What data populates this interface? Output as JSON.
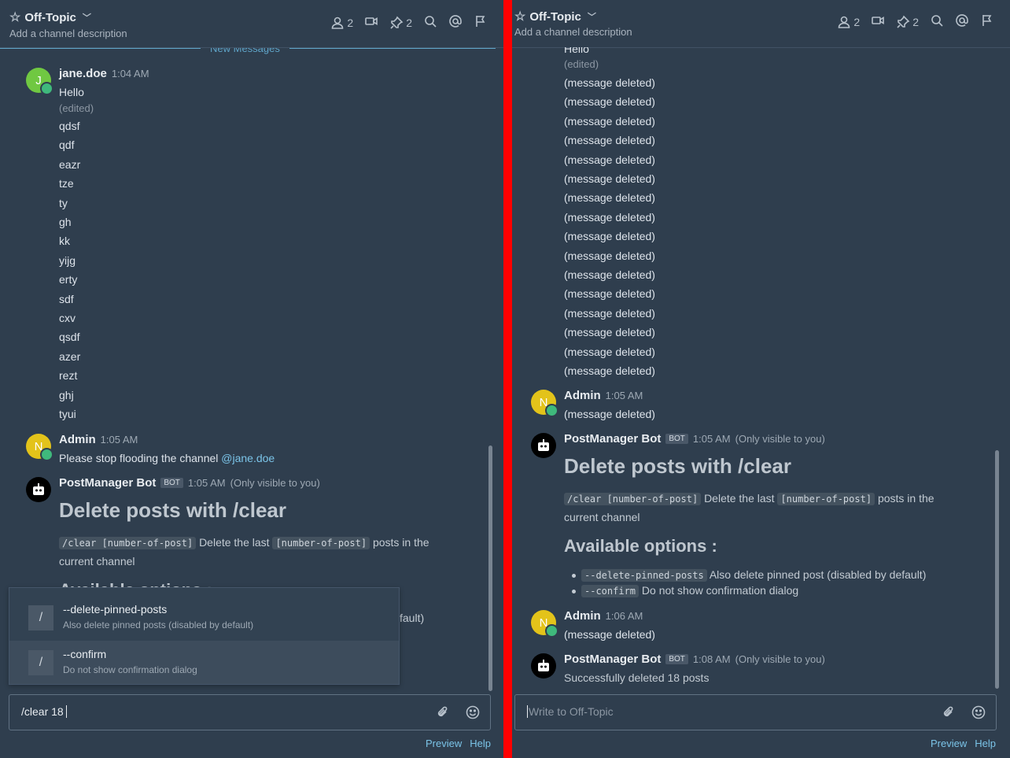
{
  "left": {
    "header": {
      "channel": "Off-Topic",
      "description": "Add a channel description",
      "members": "2",
      "pinned": "2"
    },
    "new_messages": "New Messages",
    "post1": {
      "user": "jane.doe",
      "time": "1:04 AM",
      "avatar": "J",
      "first": "Hello",
      "edited": "(edited)",
      "lines": [
        "qdsf",
        "qdf",
        "eazr",
        "tze",
        "ty",
        "gh",
        "kk",
        "yijg",
        "erty",
        "sdf",
        "cxv",
        "qsdf",
        "azer",
        "rezt",
        "ghj",
        "tyui"
      ]
    },
    "post2": {
      "user": "Admin",
      "time": "1:05 AM",
      "avatar": "N",
      "text": "Please stop flooding the channel ",
      "mention": "@jane.doe"
    },
    "post3": {
      "user": "PostManager Bot",
      "bot_badge": "BOT",
      "time": "1:05 AM",
      "visibility": "(Only visible to you)",
      "heading": "Delete posts with /clear",
      "code1": "/clear [number-of-post]",
      "desc_a": "Delete the last",
      "code2": "[number-of-post]",
      "desc_b": "posts in the",
      "desc_c": "current channel",
      "options_heading": "Available options :",
      "partial": "fault)"
    },
    "suggestions": [
      {
        "icon": "/",
        "title": "--delete-pinned-posts",
        "desc": "Also delete pinned posts (disabled by default)"
      },
      {
        "icon": "/",
        "title": "--confirm",
        "desc": "Do not show confirmation dialog"
      }
    ],
    "input_value": "/clear 18",
    "footer": {
      "preview": "Preview",
      "help": "Help"
    }
  },
  "right": {
    "header": {
      "channel": "Off-Topic",
      "description": "Add a channel description",
      "members": "2",
      "pinned": "2"
    },
    "top_hello": "Hello",
    "edited": "(edited)",
    "deleted_label": "(message deleted)",
    "deleted_count_shown": 16,
    "post_admin1": {
      "user": "Admin",
      "time": "1:05 AM",
      "avatar": "N",
      "text": "(message deleted)"
    },
    "post_bot1": {
      "user": "PostManager Bot",
      "bot_badge": "BOT",
      "time": "1:05 AM",
      "visibility": "(Only visible to you)",
      "heading": "Delete posts with /clear",
      "code1": "/clear [number-of-post]",
      "desc_a": "Delete the last",
      "code2": "[number-of-post]",
      "desc_b": "posts in the",
      "desc_c": "current channel",
      "options_heading": "Available options :",
      "opt1_code": "--delete-pinned-posts",
      "opt1_text": "Also delete pinned post (disabled by default)",
      "opt2_code": "--confirm",
      "opt2_text": "Do not show confirmation dialog"
    },
    "post_admin2": {
      "user": "Admin",
      "time": "1:06 AM",
      "avatar": "N",
      "text": "(message deleted)"
    },
    "post_bot2": {
      "user": "PostManager Bot",
      "bot_badge": "BOT",
      "time": "1:08 AM",
      "visibility": "(Only visible to you)",
      "text": "Successfully deleted 18 posts"
    },
    "input_placeholder": "Write to Off-Topic",
    "footer": {
      "preview": "Preview",
      "help": "Help"
    }
  }
}
